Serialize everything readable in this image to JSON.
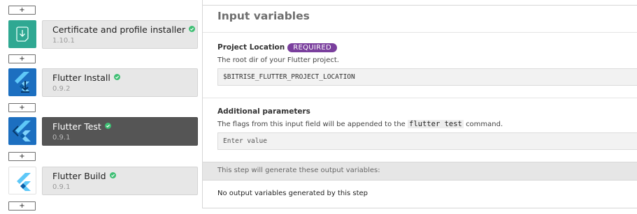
{
  "workflow": {
    "add_label": "+",
    "steps": [
      {
        "title": "Certificate and profile installer",
        "version": "1.10.1",
        "icon": "certificate-installer-icon",
        "verified": true,
        "selected": false
      },
      {
        "title": "Flutter Install",
        "version": "0.9.2",
        "icon": "flutter-install-icon",
        "verified": true,
        "selected": false
      },
      {
        "title": "Flutter Test",
        "version": "0.9.1",
        "icon": "flutter-test-icon",
        "verified": true,
        "selected": true
      },
      {
        "title": "Flutter Build",
        "version": "0.9.1",
        "icon": "flutter-build-icon",
        "verified": true,
        "selected": false
      }
    ]
  },
  "panel": {
    "title": "Input variables",
    "inputs": [
      {
        "label": "Project Location",
        "badge": "REQUIRED",
        "description": "The root dir of your Flutter project.",
        "value": "$BITRISE_FLUTTER_PROJECT_LOCATION",
        "placeholder": ""
      },
      {
        "label": "Additional parameters",
        "description_before": "The flags from this input field will be appended to the",
        "description_code": "flutter test",
        "description_after": "command.",
        "value": "",
        "placeholder": "Enter value"
      }
    ],
    "output_header": "This step will generate these output variables:",
    "output_empty": "No output variables generated by this step"
  },
  "colors": {
    "badge": "#7a3f9d",
    "verified": "#3fbf74",
    "selected_card": "#555555",
    "flutter_light": "#5ec8f8",
    "flutter_dark": "#0a5ea8",
    "certificate_bg": "#2fa892"
  }
}
